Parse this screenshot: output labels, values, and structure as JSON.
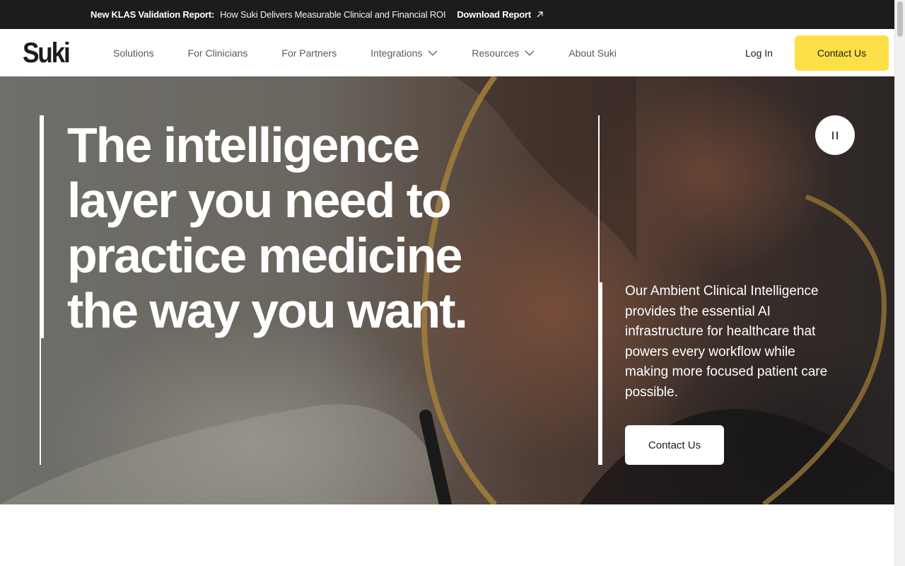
{
  "announcement": {
    "lead": "New KLAS Validation Report:",
    "message": "How Suki Delivers Measurable Clinical and Financial ROI",
    "link_label": "Download Report",
    "link_icon": "arrow-up-right-icon"
  },
  "header": {
    "logo": "Suki",
    "nav": [
      {
        "label": "Solutions"
      },
      {
        "label": "For Clinicians"
      },
      {
        "label": "For Partners"
      },
      {
        "label": "Integrations",
        "icon": "chevron-down-icon"
      },
      {
        "label": "Resources",
        "icon": "chevron-down-icon"
      },
      {
        "label": "About Suki"
      }
    ],
    "login_label": "Log In",
    "cta_label": "Contact Us"
  },
  "hero": {
    "headline_lines": [
      "The intelligence",
      "layer you need to",
      "practice medicine",
      "the way you want."
    ],
    "pause_icon": "pause-icon",
    "subtext": "Our Ambient Clinical Intelligence provides the essential AI infrastructure for healthcare that powers every workflow while making more focused patient care possible.",
    "cta_label": "Contact Us"
  },
  "colors": {
    "announcement_bg": "#1c1c1c",
    "cta_yellow": "#fde047",
    "text_dark": "#1b1b1b",
    "nav_gray": "#5a5a5a"
  }
}
